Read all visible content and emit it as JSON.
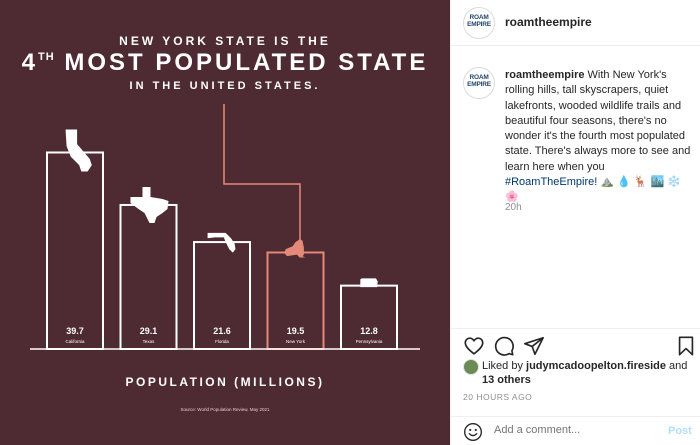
{
  "infographic": {
    "heading_line1": "NEW YORK STATE IS THE",
    "heading_rank": "4",
    "heading_rank_suffix": "TH",
    "heading_line2": "MOST POPULATED STATE",
    "heading_line3": "IN THE UNITED STATES.",
    "source": "Source: World Population Review, May 2021",
    "colors": {
      "background": "#4e2a33",
      "bar": "#ffffff",
      "highlight": "#e58a78"
    }
  },
  "chart_data": {
    "type": "bar",
    "title": "NEW YORK STATE IS THE 4TH MOST POPULATED STATE IN THE UNITED STATES.",
    "xlabel": "POPULATION (MILLIONS)",
    "ylabel": "",
    "categories": [
      "California",
      "Texas",
      "Florida",
      "New York",
      "Pennsylvania"
    ],
    "values": [
      39.7,
      29.1,
      21.6,
      19.5,
      12.8
    ],
    "value_labels": [
      "39.7",
      "29.1",
      "21.6",
      "19.5",
      "12.8"
    ],
    "highlight": "New York",
    "ylim": [
      0,
      40
    ],
    "grid": false,
    "legend": "none"
  },
  "header": {
    "avatar_text_top": "ROAM",
    "avatar_text_bottom": "EMPIRE",
    "username": "roamtheempire"
  },
  "caption": {
    "username": "roamtheempire",
    "text": "With New York's rolling hills, tall skyscrapers, quiet lakefronts, wooded wildlife trails and beautiful four seasons, there's no wonder it's the fourth most populated state. There's always more to see and learn here when you",
    "hashtag": "#RoamTheEmpire!",
    "emojis": "⛰️ 💧 🦌 🏙️ ❄️ 🌸",
    "time": "20h"
  },
  "actions": {
    "icons": [
      "heart-icon",
      "comment-icon",
      "share-icon",
      "bookmark-icon"
    ]
  },
  "likes": {
    "prefix": "Liked by ",
    "user": "judymcadoopelton.fireside",
    "conjunction": " and ",
    "others": "13 others"
  },
  "post_time": "20 HOURS AGO",
  "comment": {
    "placeholder": "Add a comment...",
    "post_label": "Post"
  }
}
